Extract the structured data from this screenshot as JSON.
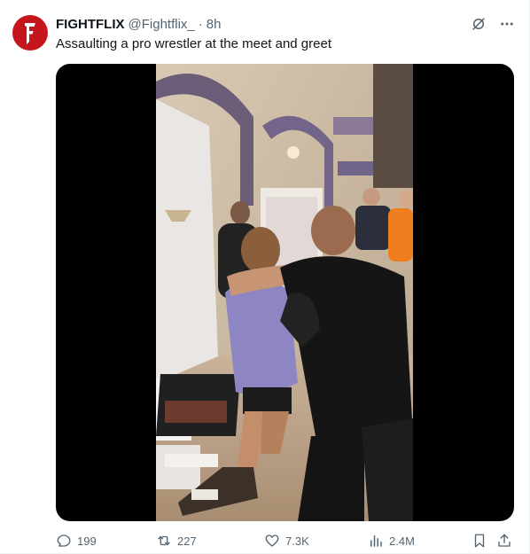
{
  "tweet": {
    "author_name": "FIGHTFLIX",
    "author_handle": "@Fightflix_",
    "separator": "·",
    "timestamp": "8h",
    "text": "Assaulting a pro wrestler at the meet and greet",
    "avatar_letter": "F"
  },
  "metrics": {
    "replies": "199",
    "retweets": "227",
    "likes": "7.3K",
    "views": "2.4M"
  },
  "colors": {
    "avatar_bg": "#c4161c",
    "text_primary": "#0f1419",
    "text_secondary": "#536471",
    "media_bg": "#000000"
  },
  "icons": [
    "grok-icon",
    "more-icon",
    "reply-icon",
    "retweet-icon",
    "like-icon",
    "views-icon",
    "bookmark-icon",
    "share-icon"
  ]
}
